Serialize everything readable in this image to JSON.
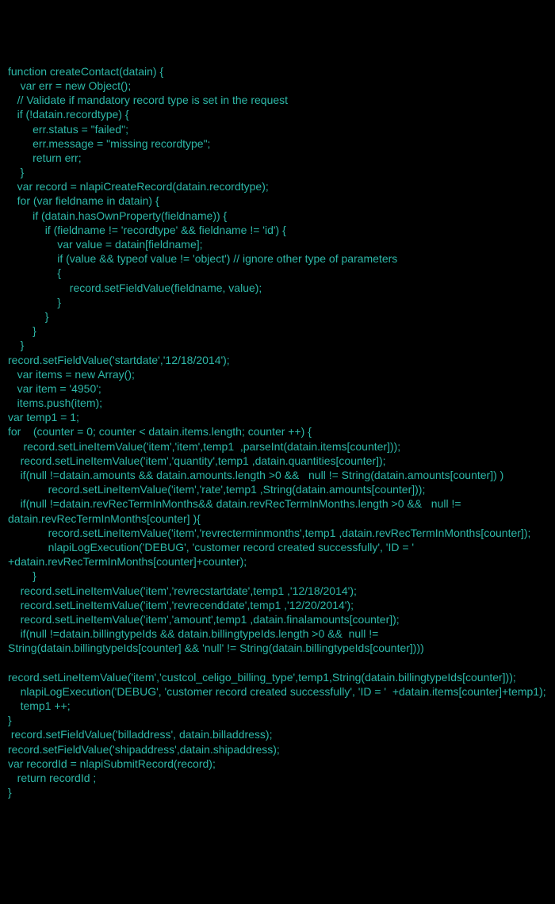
{
  "code": {
    "lines": [
      "function createContact(datain) {",
      "    var err = new Object();",
      "   // Validate if mandatory record type is set in the request",
      "   if (!datain.recordtype) {",
      "        err.status = \"failed\";",
      "        err.message = \"missing recordtype\";",
      "        return err;",
      "    }",
      "   var record = nlapiCreateRecord(datain.recordtype);",
      "   for (var fieldname in datain) {",
      "        if (datain.hasOwnProperty(fieldname)) {",
      "            if (fieldname != 'recordtype' && fieldname != 'id') {",
      "                var value = datain[fieldname];",
      "                if (value && typeof value != 'object') // ignore other type of parameters",
      "                {",
      "                    record.setFieldValue(fieldname, value);",
      "                }",
      "            }",
      "        }",
      "    }",
      "",
      "record.setFieldValue('startdate','12/18/2014');",
      "   var items = new Array();",
      "   var item = '4950';",
      "   items.push(item);",
      "",
      "var temp1 = 1;",
      "",
      "for    (counter = 0; counter < datain.items.length; counter ++) {",
      "",
      "     record.setLineItemValue('item','item',temp1  ,parseInt(datain.items[counter]));",
      "    record.setLineItemValue('item','quantity',temp1 ,datain.quantities[counter]);",
      "    if(null !=datain.amounts && datain.amounts.length >0 &&   null != String(datain.amounts[counter]) )",
      "             record.setLineItemValue('item','rate',temp1 ,String(datain.amounts[counter]));",
      "    if(null !=datain.revRecTermInMonths&& datain.revRecTermInMonths.length >0 &&   null != datain.revRecTermInMonths[counter] ){",
      "             record.setLineItemValue('item','revrecterminmonths',temp1 ,datain.revRecTermInMonths[counter]);",
      "             nlapiLogExecution('DEBUG', 'customer record created successfully', 'ID = '  +datain.revRecTermInMonths[counter]+counter);",
      "        }",
      "    record.setLineItemValue('item','revrecstartdate',temp1 ,'12/18/2014');",
      "    record.setLineItemValue('item','revrecenddate',temp1 ,'12/20/2014');",
      "    record.setLineItemValue('item','amount',temp1 ,datain.finalamounts[counter]);",
      "    if(null !=datain.billingtypeIds && datain.billingtypeIds.length >0 &&  null != String(datain.billingtypeIds[counter] && 'null' != String(datain.billingtypeIds[counter])))",
      "           record.setLineItemValue('item','custcol_celigo_billing_type',temp1,String(datain.billingtypeIds[counter]));",
      "    nlapiLogExecution('DEBUG', 'customer record created successfully', 'ID = '  +datain.items[counter]+temp1);",
      "    temp1 ++;",
      "}",
      "",
      " record.setFieldValue('billaddress', datain.billaddress);",
      "record.setFieldValue('shipaddress',datain.shipaddress);",
      "",
      "var recordId = nlapiSubmitRecord(record);",
      "   return recordId ;",
      "}"
    ]
  }
}
